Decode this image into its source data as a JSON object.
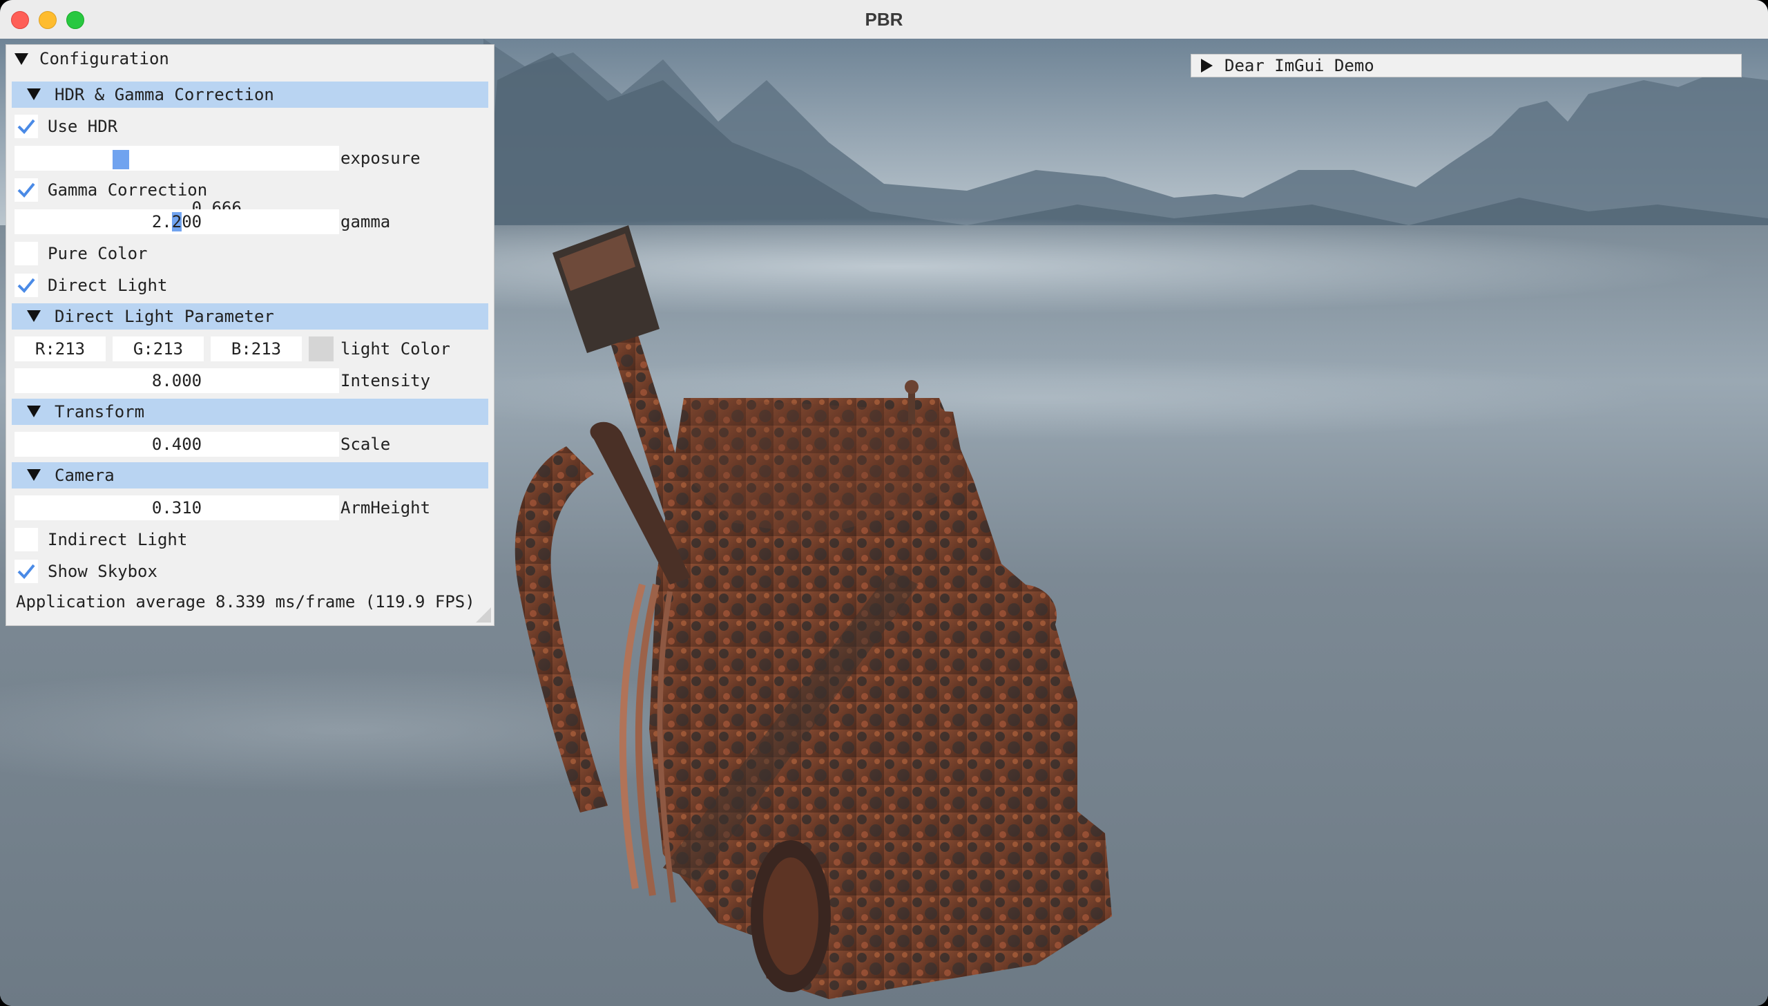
{
  "window": {
    "title": "PBR"
  },
  "config": {
    "title": "Configuration",
    "hdr_section": "HDR & Gamma Correction",
    "use_hdr": {
      "label": "Use HDR",
      "checked": true
    },
    "exposure": {
      "value": "0.666",
      "label": "exposure"
    },
    "gamma_correction": {
      "label": "Gamma Correction",
      "checked": true
    },
    "gamma": {
      "value_prefix": "2.",
      "value_highlight": "2",
      "value_suffix": "00",
      "label": "gamma"
    },
    "pure_color": {
      "label": "Pure Color",
      "checked": false
    },
    "direct_light": {
      "label": "Direct Light",
      "checked": true
    },
    "direct_light_section": "Direct Light Parameter",
    "light_color": {
      "r": "R:213",
      "g": "G:213",
      "b": "B:213",
      "label": "light Color",
      "swatch": "#d5d5d5"
    },
    "intensity": {
      "value": "8.000",
      "label": "Intensity"
    },
    "transform_section": "Transform",
    "scale": {
      "value": "0.400",
      "label": "Scale"
    },
    "camera_section": "Camera",
    "arm_height": {
      "value": "0.310",
      "label": "ArmHeight"
    },
    "indirect_light": {
      "label": "Indirect Light",
      "checked": false
    },
    "show_skybox": {
      "label": "Show Skybox",
      "checked": true
    },
    "fps_text": "Application average 8.339 ms/frame (119.9 FPS)"
  },
  "demo_window": {
    "title": "Dear ImGui Demo"
  },
  "colors": {
    "header_bg": "#b9d4f2",
    "check_color": "#4a8ae6",
    "slider_grab": "#70a3ef"
  },
  "icons": [
    "close-traffic-light",
    "minimize-traffic-light",
    "zoom-traffic-light",
    "collapse-arrow-icon",
    "expand-arrow-icon",
    "checkmark-icon"
  ]
}
